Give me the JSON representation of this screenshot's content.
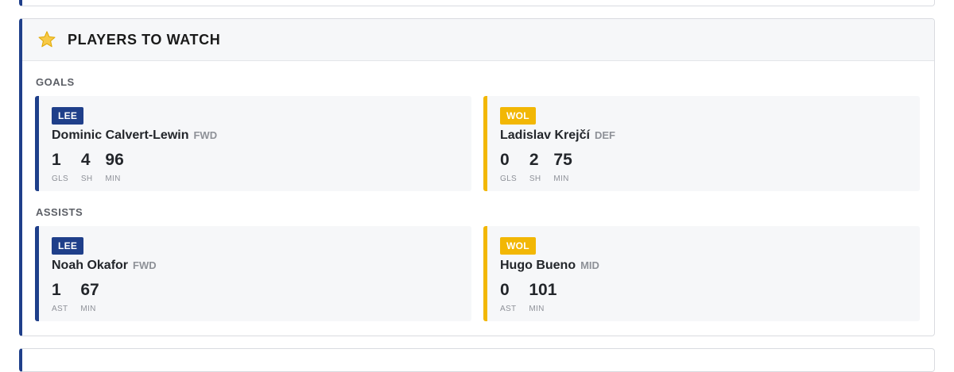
{
  "header": {
    "title": "PLAYERS TO WATCH",
    "icon": "star-icon"
  },
  "colors": {
    "lee": "#1f3f8a",
    "wol": "#f2b705"
  },
  "sections": {
    "goals": {
      "label": "GOALS",
      "players": [
        {
          "team": "LEE",
          "name": "Dominic Calvert-Lewin",
          "position": "FWD",
          "stats": [
            {
              "value": "1",
              "label": "GLS"
            },
            {
              "value": "4",
              "label": "SH"
            },
            {
              "value": "96",
              "label": "MIN"
            }
          ]
        },
        {
          "team": "WOL",
          "name": "Ladislav Krejčí",
          "position": "DEF",
          "stats": [
            {
              "value": "0",
              "label": "GLS"
            },
            {
              "value": "2",
              "label": "SH"
            },
            {
              "value": "75",
              "label": "MIN"
            }
          ]
        }
      ]
    },
    "assists": {
      "label": "ASSISTS",
      "players": [
        {
          "team": "LEE",
          "name": "Noah Okafor",
          "position": "FWD",
          "stats": [
            {
              "value": "1",
              "label": "AST"
            },
            {
              "value": "67",
              "label": "MIN"
            }
          ]
        },
        {
          "team": "WOL",
          "name": "Hugo Bueno",
          "position": "MID",
          "stats": [
            {
              "value": "0",
              "label": "AST"
            },
            {
              "value": "101",
              "label": "MIN"
            }
          ]
        }
      ]
    }
  }
}
